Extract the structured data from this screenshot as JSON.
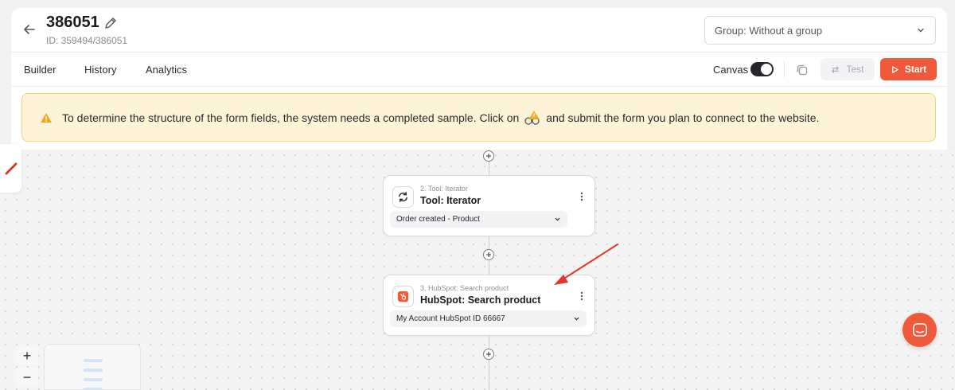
{
  "header": {
    "title": "386051",
    "subtitle": "ID: 359494/386051",
    "group_select": "Group: Without a group"
  },
  "tabs": [
    {
      "label": "Builder"
    },
    {
      "label": "History"
    },
    {
      "label": "Analytics"
    }
  ],
  "toolbar": {
    "canvas_label": "Canvas",
    "canvas_enabled": true,
    "test_label": "Test",
    "start_label": "Start"
  },
  "alert": {
    "text_before": "To determine the structure of the form fields, the system needs a completed sample. Click on",
    "text_after": "and submit the form you plan to connect to the website."
  },
  "nodes": [
    {
      "caption": "2. Tool: Iterator",
      "title": "Tool: Iterator",
      "select": "Order created - Product"
    },
    {
      "caption": "3. HubSpot: Search product",
      "title": "HubSpot: Search product",
      "select": "My Account HubSpot ID 66667"
    }
  ],
  "zoom": {
    "in": "+",
    "out": "−"
  },
  "colors": {
    "accent": "#f05a3b",
    "alert_bg": "#fdf4d8",
    "alert_border": "#f2d37d",
    "annotation_arrow": "#e5342a"
  },
  "icons": {
    "back": "arrow-left-icon",
    "edit": "pencil-icon",
    "iterator": "cycle-arrows-icon",
    "hubspot": "hubspot-logo-icon",
    "chat": "chat-bubble-icon"
  }
}
